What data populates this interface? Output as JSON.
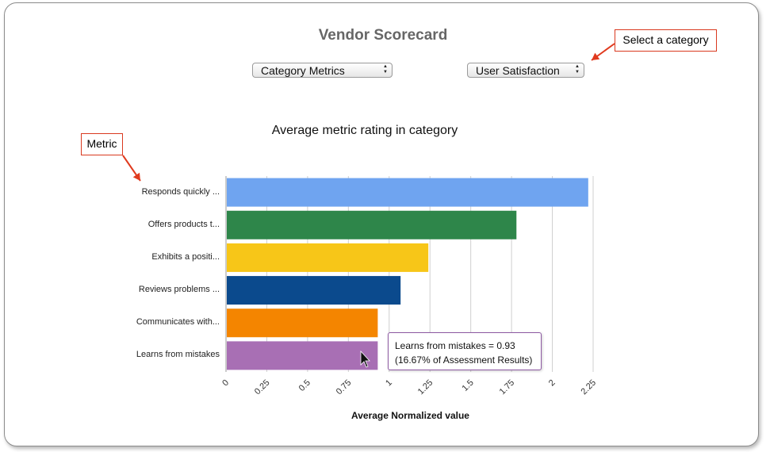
{
  "page": {
    "title": "Vendor Scorecard"
  },
  "controls": {
    "category_metrics_select": "Category Metrics",
    "category_select": "User Satisfaction"
  },
  "callouts": {
    "select_category": "Select a category",
    "metric": "Metric"
  },
  "colors": {
    "callout_border": "#d9391f",
    "tooltip_border": "#8e5aa3"
  },
  "chart_data": {
    "type": "bar",
    "orientation": "horizontal",
    "title": "Average metric rating in category",
    "xlabel": "Average Normalized value",
    "ylabel": "",
    "categories": [
      "Responds quickly ...",
      "Offers products t...",
      "Exhibits a positi...",
      "Reviews problems ...",
      "Communicates with...",
      "Learns from mistakes"
    ],
    "values": [
      2.22,
      1.78,
      1.24,
      1.07,
      0.93,
      0.93
    ],
    "bar_colors": [
      "#6fa4f0",
      "#2e864a",
      "#f7c618",
      "#0b4a8d",
      "#f48500",
      "#a86fb4"
    ],
    "xlim": [
      0,
      2.25
    ],
    "xticks": [
      "0",
      "0.25",
      "0.5",
      "0.75",
      "1",
      "1.25",
      "1.5",
      "1.75",
      "2",
      "2.25"
    ],
    "xtick_values": [
      0,
      0.25,
      0.5,
      0.75,
      1,
      1.25,
      1.5,
      1.75,
      2,
      2.25
    ],
    "grid": true,
    "legend": "none",
    "tooltip": {
      "line1": "Learns from mistakes = 0.93",
      "line2": "(16.67% of Assessment Results)"
    }
  }
}
